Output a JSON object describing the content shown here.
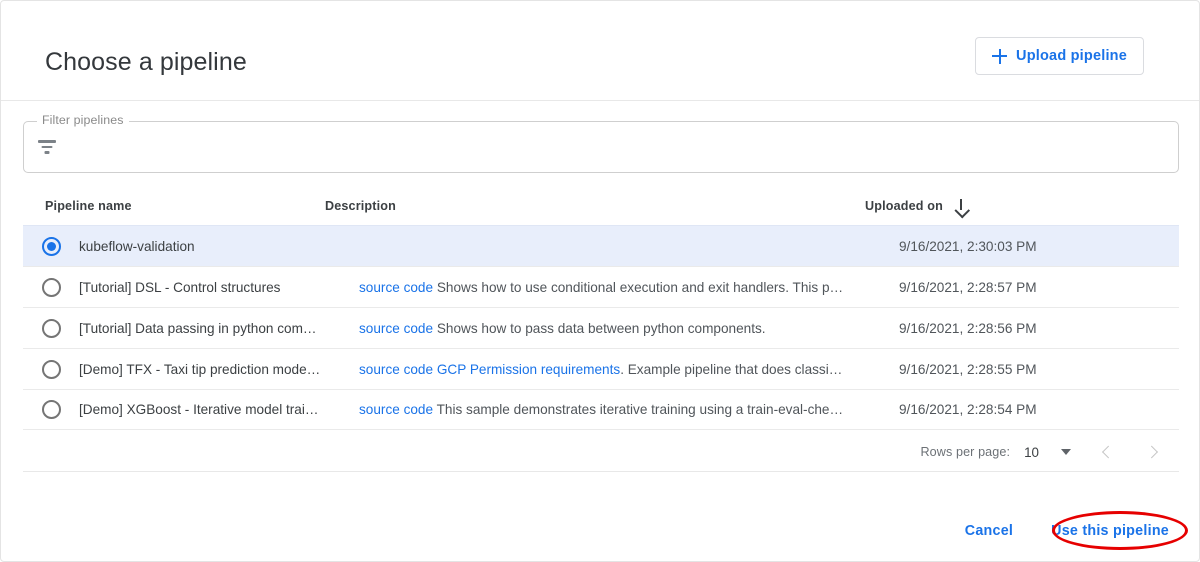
{
  "dialog": {
    "title": "Choose a pipeline",
    "upload_button": "Upload pipeline",
    "plus_icon": "plus-icon"
  },
  "filter": {
    "label": "Filter pipelines",
    "value": "",
    "placeholder": "",
    "icon": "filter-icon"
  },
  "table": {
    "headers": {
      "name": "Pipeline name",
      "description": "Description",
      "uploaded": "Uploaded on",
      "sort_icon": "arrow-down-icon"
    },
    "rows": [
      {
        "selected": true,
        "name": "kubeflow-validation",
        "desc_links": [],
        "desc_text": "",
        "date": "9/16/2021, 2:30:03 PM"
      },
      {
        "selected": false,
        "name": "[Tutorial] DSL - Control structures",
        "desc_links": [
          "source code"
        ],
        "desc_text": "Shows how to use conditional execution and exit handlers. This p…",
        "date": "9/16/2021, 2:28:57 PM"
      },
      {
        "selected": false,
        "name": "[Tutorial] Data passing in python com…",
        "desc_links": [
          "source code"
        ],
        "desc_text": "Shows how to pass data between python components.",
        "date": "9/16/2021, 2:28:56 PM"
      },
      {
        "selected": false,
        "name": "[Demo] TFX - Taxi tip prediction mode…",
        "desc_links": [
          "source code",
          "GCP Permission requirements"
        ],
        "desc_text": ". Example pipeline that does classi…",
        "date": "9/16/2021, 2:28:55 PM"
      },
      {
        "selected": false,
        "name": "[Demo] XGBoost - Iterative model trai…",
        "desc_links": [
          "source code"
        ],
        "desc_text": "This sample demonstrates iterative training using a train-eval-che…",
        "date": "9/16/2021, 2:28:54 PM"
      }
    ]
  },
  "paginator": {
    "rows_per_page_label": "Rows per page:",
    "rows_per_page_value": "10",
    "caret_icon": "chevron-down-icon",
    "prev_icon": "chevron-left-icon",
    "next_icon": "chevron-right-icon"
  },
  "actions": {
    "cancel": "Cancel",
    "confirm": "Use this pipeline"
  },
  "annotation": {
    "shape": "ellipse-highlight",
    "color": "#e60000"
  }
}
